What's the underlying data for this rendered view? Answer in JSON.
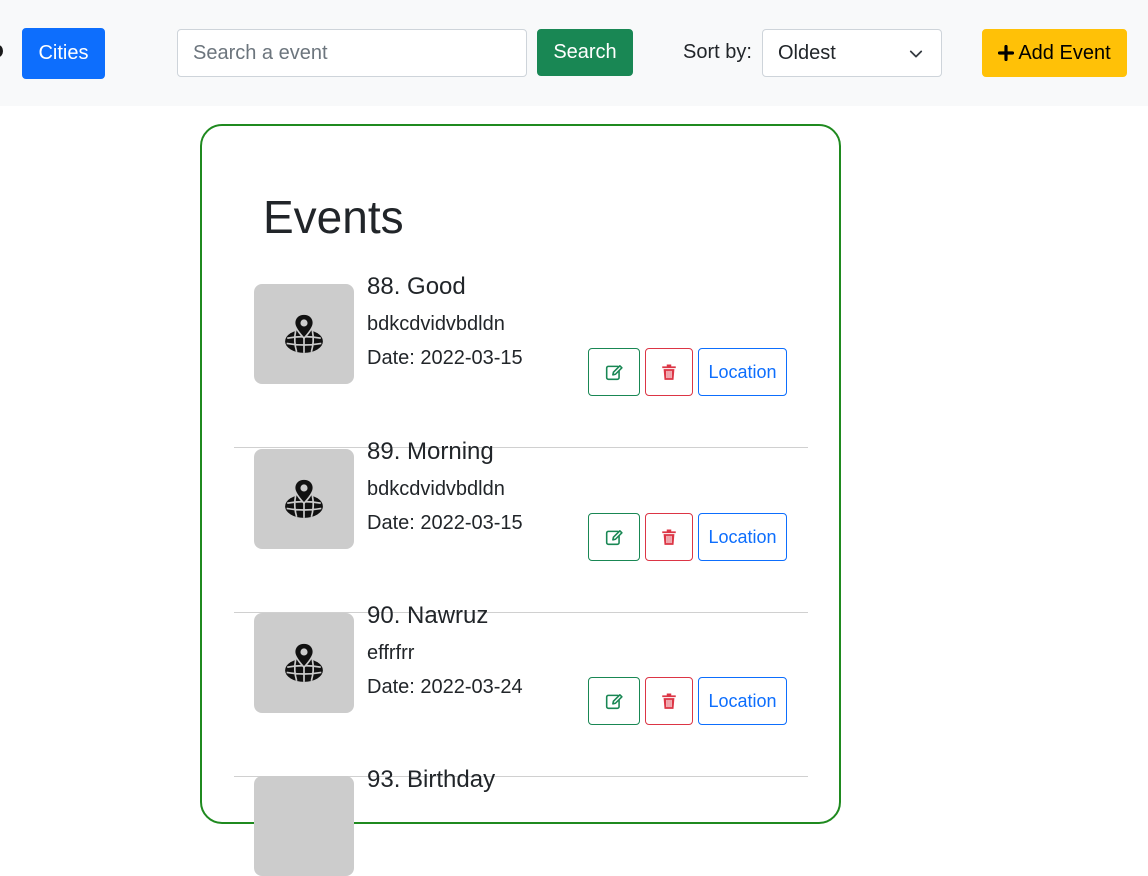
{
  "navbar": {
    "cities_label": "Cities",
    "search": {
      "placeholder": "Search a event",
      "value": ""
    },
    "search_label": "Search",
    "sort": {
      "label": "Sort by:",
      "selected": "Oldest"
    },
    "add_label": "Add Event"
  },
  "events": {
    "title": "Events",
    "location_label": "Location",
    "items": [
      {
        "name": "88. Good",
        "description": "bdkcdvidvbdldn",
        "date": "Date: 2022-03-15"
      },
      {
        "name": "89. Morning",
        "description": "bdkcdvidvbdldn",
        "date": "Date: 2022-03-15"
      },
      {
        "name": "90. Nawruz",
        "description": "effrfrr",
        "date": "Date: 2022-03-24"
      },
      {
        "name": "93. Birthday"
      }
    ]
  },
  "icons": {
    "thumbnail": "map-pin-globe-icon",
    "edit": "pencil-square-icon",
    "delete": "trash-icon",
    "add": "plus-icon",
    "sort": "chevron-down-icon"
  },
  "colors": {
    "navbar_bg": "#f8f9fa",
    "primary": "#0d6efd",
    "success": "#198754",
    "danger": "#dc3545",
    "warning": "#ffc107",
    "card_border": "#1f8a1f",
    "thumb_bg": "#cccccc"
  }
}
